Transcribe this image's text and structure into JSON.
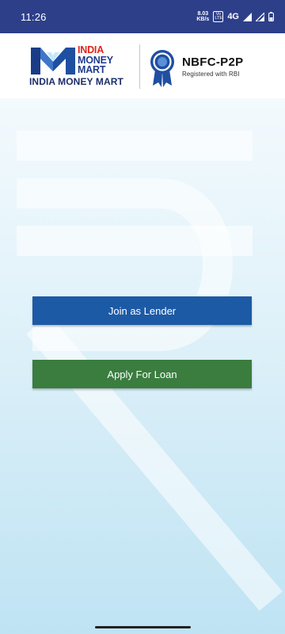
{
  "status_bar": {
    "time": "11:26",
    "speed_value": "8.03",
    "speed_unit": "KB/s",
    "volte_line1": "Vo",
    "volte_line2": "LTE",
    "network": "4G",
    "background_color": "#2e3f8a"
  },
  "header": {
    "logo_line1": "INDIA",
    "logo_line2": "MONEY",
    "logo_line3": "MART",
    "logo_caption": "INDIA MONEY MART",
    "badge_title": "NBFC-P2P",
    "badge_subtitle": "Registered with RBI",
    "brand_red": "#e2231a",
    "brand_blue": "#1f3c8f"
  },
  "actions": {
    "lender_label": "Join as Lender",
    "loan_label": "Apply For Loan",
    "lender_color": "#1c5aa5",
    "loan_color": "#3a7d3f"
  }
}
